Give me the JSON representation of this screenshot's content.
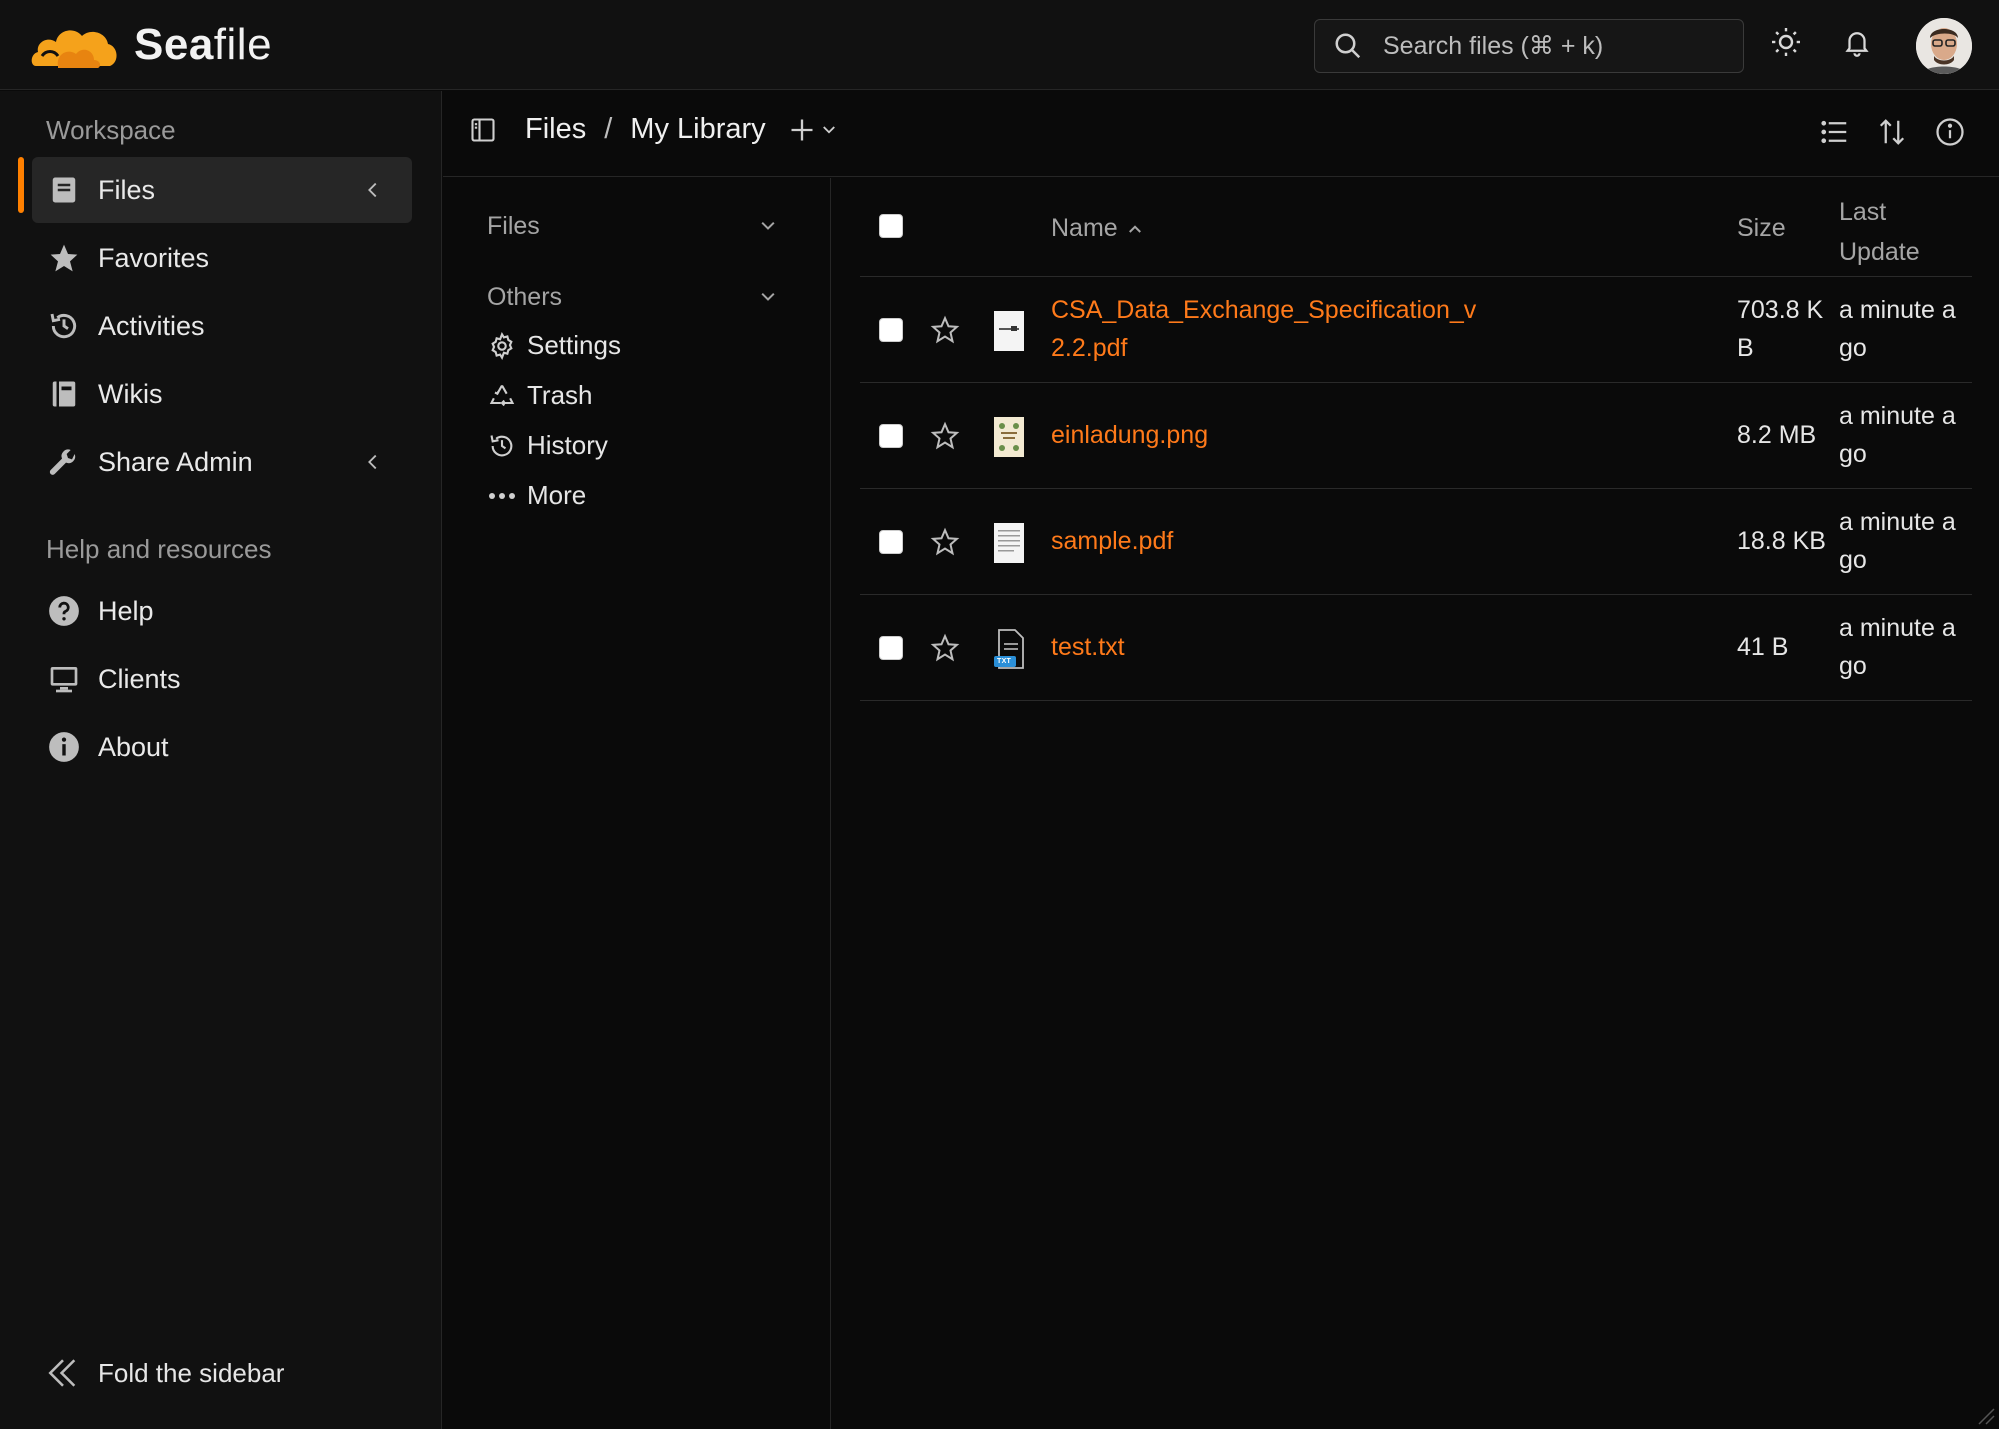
{
  "app": {
    "logo_prefix": "Sea",
    "logo_suffix": "file"
  },
  "header": {
    "search_placeholder": "Search files (⌘ + k)"
  },
  "sidebar": {
    "workspace_title": "Workspace",
    "items": [
      {
        "label": "Files",
        "icon": "files-icon"
      },
      {
        "label": "Favorites",
        "icon": "star-icon"
      },
      {
        "label": "Activities",
        "icon": "activities-icon"
      },
      {
        "label": "Wikis",
        "icon": "wiki-icon"
      },
      {
        "label": "Share Admin",
        "icon": "wrench-icon"
      }
    ],
    "help_title": "Help and resources",
    "help_items": [
      {
        "label": "Help",
        "icon": "question-icon"
      },
      {
        "label": "Clients",
        "icon": "monitor-icon"
      },
      {
        "label": "About",
        "icon": "info-icon"
      }
    ],
    "fold_label": "Fold the sidebar"
  },
  "path": {
    "root": "Files",
    "separator": "/",
    "library": "My Library"
  },
  "tree": {
    "files_label": "Files",
    "others_label": "Others",
    "items": [
      {
        "label": "Settings",
        "icon": "settings-icon"
      },
      {
        "label": "Trash",
        "icon": "trash-icon"
      },
      {
        "label": "History",
        "icon": "history-icon"
      },
      {
        "label": "More",
        "icon": "more-icon"
      }
    ]
  },
  "table": {
    "columns": {
      "name": "Name",
      "size": "Size",
      "last_update_line1": "Last",
      "last_update_line2": "Update"
    },
    "rows": [
      {
        "name_line1": "CSA_Data_Exchange_Specification_v",
        "name_line2": "2.2.pdf",
        "size_line1": "703.8 K",
        "size_line2": "B",
        "date_line1": "a minute a",
        "date_line2": "go",
        "type": "pdf"
      },
      {
        "name_line1": "einladung.png",
        "name_line2": "",
        "size_line1": "8.2 MB",
        "size_line2": "",
        "date_line1": "a minute a",
        "date_line2": "go",
        "type": "png"
      },
      {
        "name_line1": "sample.pdf",
        "name_line2": "",
        "size_line1": "18.8 KB",
        "size_line2": "",
        "date_line1": "a minute a",
        "date_line2": "go",
        "type": "pdf"
      },
      {
        "name_line1": "test.txt",
        "name_line2": "",
        "size_line1": "41 B",
        "size_line2": "",
        "date_line1": "a minute a",
        "date_line2": "go",
        "type": "txt",
        "badge": "TXT"
      }
    ]
  },
  "colors": {
    "accent": "#ff8000",
    "link": "#ff7a1a",
    "background": "#0a0a0a",
    "panel": "#111111"
  }
}
